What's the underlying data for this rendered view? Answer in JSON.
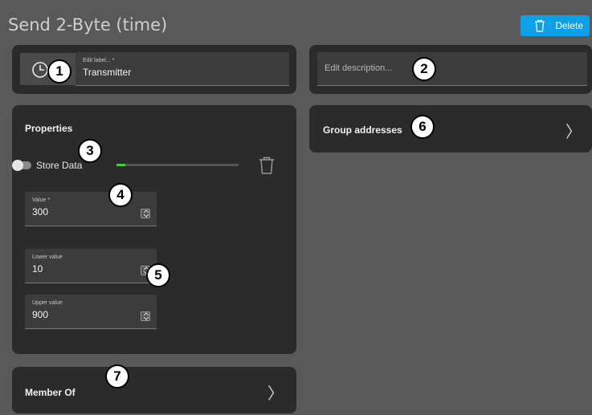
{
  "header": {
    "title": "Send 2-Byte (time)",
    "delete_label": "Delete"
  },
  "label_field": {
    "label": "Edit label... *",
    "value": "Transmitter"
  },
  "description_field": {
    "placeholder": "Edit description..."
  },
  "properties": {
    "title": "Properties",
    "store_data_label": "Store Data",
    "store_data_on": false,
    "value_field": {
      "label": "Value *",
      "value": "300"
    },
    "lower_field": {
      "label": "Lower value",
      "value": "10"
    },
    "upper_field": {
      "label": "Upper value",
      "value": "900"
    }
  },
  "group_addresses": {
    "title": "Group addresses"
  },
  "member_of": {
    "title": "Member Of"
  },
  "badges": [
    "1",
    "2",
    "3",
    "4",
    "5",
    "6",
    "7"
  ],
  "colors": {
    "accent": "#0d9fe8",
    "progress": "#3bd13b",
    "card": "#2b2b2b",
    "background": "#595959"
  },
  "icons": {
    "clock": "clock-icon",
    "trash": "trash-icon",
    "spinner": "spinner-icon",
    "chevron": "chevron-right-icon"
  }
}
